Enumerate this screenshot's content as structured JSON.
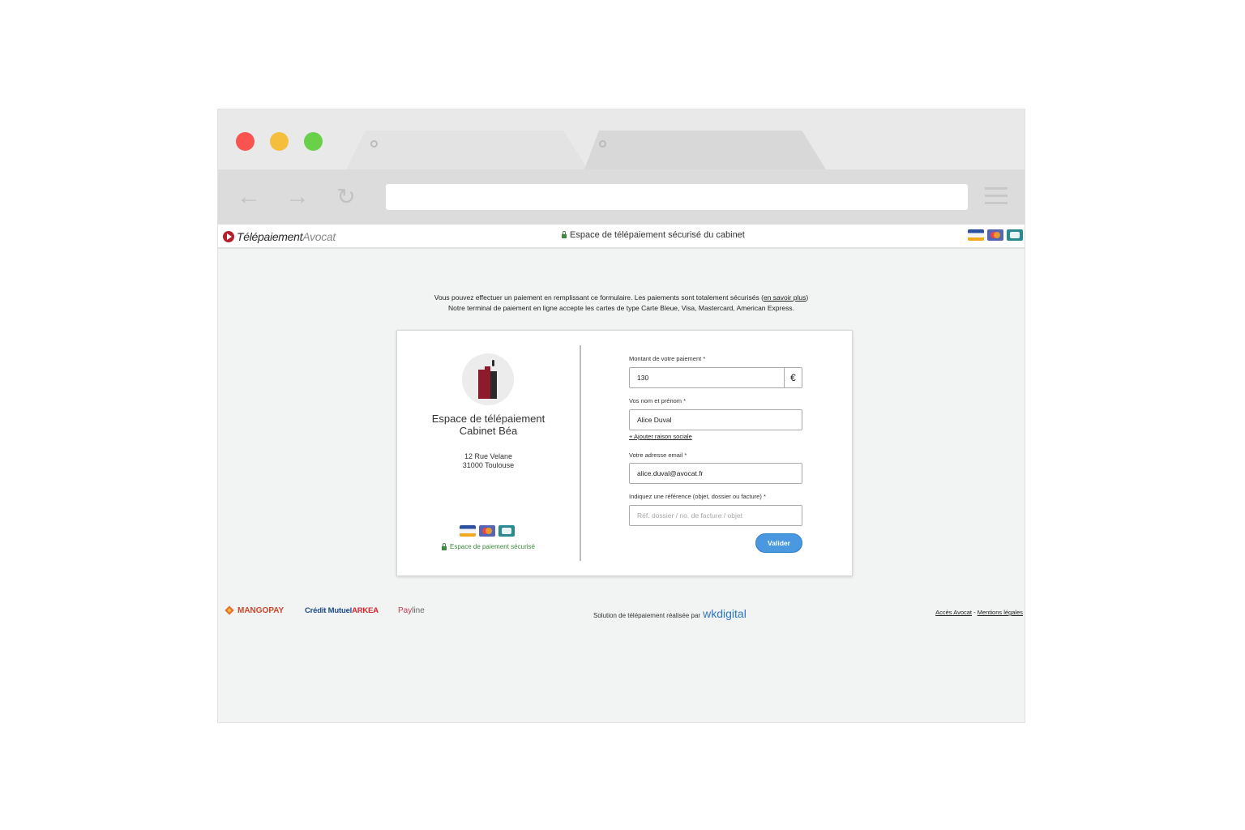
{
  "header": {
    "logo_main": "Télépaiement",
    "logo_sub": "Avocat",
    "secure_title": "Espace de télépaiement sécurisé du cabinet"
  },
  "intro": {
    "line1_before": "Vous pouvez effectuer un paiement en remplissant ce formulaire. Les paiements sont totalement sécurisés (",
    "link": "en savoir plus",
    "line1_after": ")",
    "line2": "Notre terminal de paiement en ligne accepte les cartes de type Carte Bleue, Visa, Mastercard, American Express."
  },
  "firm": {
    "title_line1": "Espace de télépaiement",
    "title_line2": "Cabinet Béa",
    "address_line1": "12 Rue Velane",
    "address_line2": "31000 Toulouse",
    "secure_note": "Espace de paiement sécurisé"
  },
  "form": {
    "amount_label": "Montant de votre paiement",
    "amount_value": "130",
    "currency": "€",
    "name_label": "Vos nom et prénom",
    "name_value": "Alice Duval",
    "add_company_link": "+ Ajouter raison sociale",
    "email_label": "Votre adresse email",
    "email_value": "alice.duval@avocat.fr",
    "reference_label": "Indiquez une référence (objet, dossier ou facture)",
    "reference_placeholder": "Réf. dossier / no. de facture / objet",
    "required_mark": "*",
    "submit_label": "Valider"
  },
  "footer": {
    "mangopay": "MANGOPAY",
    "cm_main": "Crédit Mutuel",
    "cm_sub": "ARKEA",
    "payline_a": "Pay",
    "payline_b": "line",
    "solution_text": "Solution de télépaiement réalisée par",
    "wk_a": "wk",
    "wk_b": "digital",
    "acces_avocat": "Accès Avocat",
    "separator": "-",
    "mentions": "Mentions légales"
  },
  "colors": {
    "accent_blue": "#4a98e0",
    "brand_red": "#8c1b2c",
    "secure_green": "#3b8a3e"
  }
}
